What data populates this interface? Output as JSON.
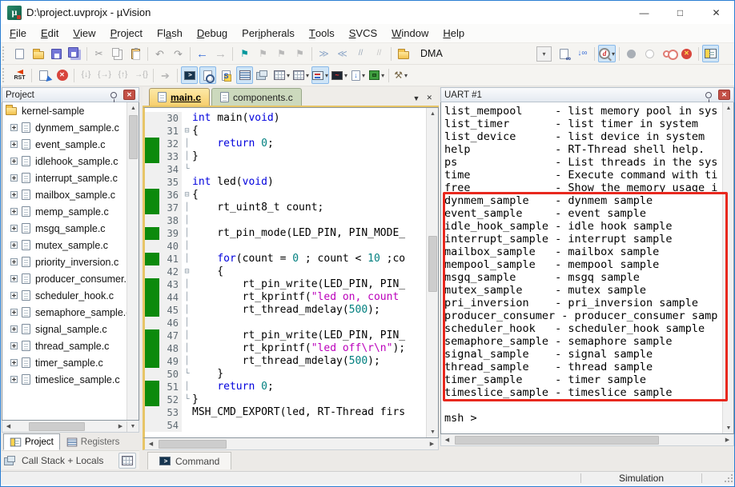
{
  "window": {
    "title": "D:\\project.uvprojx - µVision",
    "controls": {
      "minimize": "—",
      "maximize": "□",
      "close": "✕"
    }
  },
  "menu": {
    "items": [
      {
        "t": "File",
        "u": 0
      },
      {
        "t": "Edit",
        "u": 0
      },
      {
        "t": "View",
        "u": 0
      },
      {
        "t": "Project",
        "u": 0
      },
      {
        "t": "Flash",
        "u": 2
      },
      {
        "t": "Debug",
        "u": 0
      },
      {
        "t": "Peripherals",
        "u": 3
      },
      {
        "t": "Tools",
        "u": 0
      },
      {
        "t": "SVCS",
        "u": 0
      },
      {
        "t": "Window",
        "u": 0
      },
      {
        "t": "Help",
        "u": 0
      }
    ]
  },
  "toolbars": {
    "row1": [
      {
        "n": "new-file-button",
        "cls": "i-doc"
      },
      {
        "n": "open-file-button",
        "cls": "i-folder"
      },
      {
        "n": "save-button",
        "cls": "i-floppy"
      },
      {
        "n": "save-all-button",
        "cls": "i-floppy2"
      },
      {
        "sep": true
      },
      {
        "n": "cut-button",
        "g": "✂",
        "c": "#9a9a9a",
        "fs": 12
      },
      {
        "n": "copy-button",
        "cls": "i-copy"
      },
      {
        "n": "paste-button",
        "cls": "i-clip"
      },
      {
        "sep": true
      },
      {
        "n": "undo-button",
        "g": "↶",
        "c": "#9a9a9a",
        "fs": 13
      },
      {
        "n": "redo-button",
        "g": "↷",
        "c": "#9a9a9a",
        "fs": 13
      },
      {
        "sep": true
      },
      {
        "n": "navigate-back-button",
        "g": "←",
        "c": "#3a6fd8",
        "fs": 15
      },
      {
        "n": "navigate-forward-button",
        "g": "→",
        "c": "#b9b9b9",
        "fs": 15
      },
      {
        "sep": true
      },
      {
        "n": "insert-bookmark-button",
        "g": "⚑",
        "c": "#00979c",
        "fs": 12
      },
      {
        "n": "previous-bookmark-button",
        "g": "⚑",
        "c": "#b9b9b9",
        "fs": 12
      },
      {
        "n": "next-bookmark-button",
        "g": "⚑",
        "c": "#b9b9b9",
        "fs": 12
      },
      {
        "n": "clear-bookmarks-button",
        "g": "⚑",
        "c": "#b9b9b9",
        "fs": 12
      },
      {
        "sep": true
      },
      {
        "n": "indent-button",
        "g": "≫",
        "c": "#8fa8c8",
        "fs": 12
      },
      {
        "n": "outdent-button",
        "g": "≪",
        "c": "#8fa8c8",
        "fs": 12
      },
      {
        "n": "comment-button",
        "g": "//",
        "c": "#9aa8b8",
        "fs": 10
      },
      {
        "n": "uncomment-button",
        "g": "//",
        "c": "#c3c3c3",
        "fs": 10
      },
      {
        "sep": true
      },
      {
        "n": "configure-target-button",
        "cls": "i-folder"
      },
      {
        "n": "target-select",
        "combo": true,
        "v": "DMA"
      },
      {
        "n": "find-in-files-button",
        "cls": "i-docfind"
      },
      {
        "n": "incremental-find-button",
        "g": "↓∞",
        "c": "#3a6fd8",
        "fs": 10
      },
      {
        "sep": true
      },
      {
        "n": "find-button",
        "cls": "i-qfind",
        "hl": true,
        "dd": true
      },
      {
        "sep": true
      },
      {
        "n": "insert-breakpoint-button",
        "cls": "i-bp-gray"
      },
      {
        "n": "enable-disable-breakpoint-button",
        "cls": "i-bp-hollow"
      },
      {
        "n": "disable-all-breakpoints-button",
        "cls": "i-bp-red2"
      },
      {
        "n": "kill-all-breakpoints-button",
        "cls": "i-bp-redx"
      },
      {
        "sep": true
      },
      {
        "n": "project-window-toggle-button",
        "cls": "i-projwin",
        "hl": true
      }
    ],
    "row2": [
      {
        "n": "reset-button",
        "cls": "i-rst",
        "g": "RST"
      },
      {
        "sep": true
      },
      {
        "n": "run-button",
        "cls": "i-run"
      },
      {
        "n": "stop-button",
        "cls": "i-stopx"
      },
      {
        "sep": true
      },
      {
        "n": "step-button",
        "g": "{↓}",
        "c": "#b5b5b5",
        "fs": 10
      },
      {
        "n": "step-over-button",
        "g": "{→}",
        "c": "#b5b5b5",
        "fs": 10
      },
      {
        "n": "step-out-button",
        "g": "{↑}",
        "c": "#b5b5b5",
        "fs": 10
      },
      {
        "n": "run-to-cursor-button",
        "g": "→{}",
        "c": "#b5b5b5",
        "fs": 10
      },
      {
        "sep": true
      },
      {
        "n": "show-next-statement-button",
        "g": "➔",
        "c": "#b5b5b5",
        "fs": 13
      },
      {
        "sep": true
      },
      {
        "n": "command-window-button",
        "cls": "i-console",
        "hl": true
      },
      {
        "n": "disassembly-window-button",
        "cls": "i-disasm",
        "hl": true
      },
      {
        "n": "symbols-window-button",
        "cls": "i-symbols"
      },
      {
        "n": "registers-window-button",
        "cls": "i-reglines",
        "hl": true
      },
      {
        "n": "call-stack-window-button",
        "cls": "i-stack"
      },
      {
        "n": "watch-window-button",
        "cls": "i-grid",
        "dd": true
      },
      {
        "n": "memory-window-button",
        "cls": "i-grid",
        "dd": true
      },
      {
        "n": "serial-window-button",
        "cls": "i-serial",
        "hl": true,
        "dd": true
      },
      {
        "n": "analysis-window-button",
        "cls": "i-analysis",
        "dd": true
      },
      {
        "n": "trace-window-button",
        "cls": "i-trace",
        "dd": true
      },
      {
        "n": "system-viewer-button",
        "cls": "i-chip",
        "dd": true
      },
      {
        "sep": true
      },
      {
        "n": "toolbox-button",
        "g": "⚒",
        "c": "#7a6a4a",
        "fs": 12,
        "dd": true
      }
    ]
  },
  "project": {
    "title": "Project",
    "root": "kernel-sample",
    "files": [
      "dynmem_sample.c",
      "event_sample.c",
      "idlehook_sample.c",
      "interrupt_sample.c",
      "mailbox_sample.c",
      "memp_sample.c",
      "msgq_sample.c",
      "mutex_sample.c",
      "priority_inversion.c",
      "producer_consumer.c",
      "scheduler_hook.c",
      "semaphore_sample.c",
      "signal_sample.c",
      "thread_sample.c",
      "timer_sample.c",
      "timeslice_sample.c"
    ],
    "tabs": [
      {
        "label": "Project",
        "icon": "i-projwin",
        "active": true
      },
      {
        "label": "Registers",
        "icon": "i-reglines",
        "active": false
      }
    ],
    "callstack_label": "Call Stack + Locals"
  },
  "editor": {
    "tabs": [
      {
        "label": "main.c",
        "active": true
      },
      {
        "label": "components.c",
        "active": false
      }
    ],
    "lines": [
      {
        "n": 30,
        "f": "",
        "b": 0,
        "t": [
          [
            "k",
            "int"
          ],
          [
            "p",
            " main("
          ],
          [
            "k",
            "void"
          ],
          [
            "p",
            ")"
          ]
        ]
      },
      {
        "n": 31,
        "f": "⊟",
        "b": 0,
        "t": [
          [
            "p",
            "{"
          ]
        ]
      },
      {
        "n": 32,
        "f": "│",
        "b": 1,
        "t": [
          [
            "p",
            "    "
          ],
          [
            "k",
            "return"
          ],
          [
            "p",
            " "
          ],
          [
            "nu",
            "0"
          ],
          [
            "p",
            ";"
          ]
        ]
      },
      {
        "n": 33,
        "f": "│",
        "b": 1,
        "t": [
          [
            "p",
            "}"
          ]
        ]
      },
      {
        "n": 34,
        "f": "└",
        "b": 0,
        "t": []
      },
      {
        "n": 35,
        "f": "",
        "b": 0,
        "t": [
          [
            "k",
            "int"
          ],
          [
            "p",
            " led("
          ],
          [
            "k",
            "void"
          ],
          [
            "p",
            ")"
          ]
        ]
      },
      {
        "n": 36,
        "f": "⊟",
        "b": 1,
        "t": [
          [
            "p",
            "{"
          ]
        ]
      },
      {
        "n": 37,
        "f": "│",
        "b": 1,
        "t": [
          [
            "p",
            "    rt_uint8_t count;"
          ]
        ]
      },
      {
        "n": 38,
        "f": "│",
        "b": 0,
        "t": []
      },
      {
        "n": 39,
        "f": "│",
        "b": 1,
        "t": [
          [
            "p",
            "    rt_pin_mode(LED_PIN, PIN_MODE_"
          ]
        ]
      },
      {
        "n": 40,
        "f": "│",
        "b": 0,
        "t": []
      },
      {
        "n": 41,
        "f": "│",
        "b": 1,
        "t": [
          [
            "p",
            "    "
          ],
          [
            "k",
            "for"
          ],
          [
            "p",
            "(count = "
          ],
          [
            "nu",
            "0"
          ],
          [
            "p",
            " ; count < "
          ],
          [
            "nu",
            "10"
          ],
          [
            "p",
            " ;co"
          ]
        ]
      },
      {
        "n": 42,
        "f": "⊟",
        "b": 0,
        "t": [
          [
            "p",
            "    {"
          ]
        ]
      },
      {
        "n": 43,
        "f": "│",
        "b": 1,
        "t": [
          [
            "p",
            "        rt_pin_write(LED_PIN, PIN_"
          ]
        ]
      },
      {
        "n": 44,
        "f": "│",
        "b": 1,
        "t": [
          [
            "p",
            "        rt_kprintf("
          ],
          [
            "s",
            "\"led on, count"
          ]
        ]
      },
      {
        "n": 45,
        "f": "│",
        "b": 1,
        "t": [
          [
            "p",
            "        rt_thread_mdelay("
          ],
          [
            "nu",
            "500"
          ],
          [
            "p",
            ");"
          ]
        ]
      },
      {
        "n": 46,
        "f": "│",
        "b": 0,
        "t": []
      },
      {
        "n": 47,
        "f": "│",
        "b": 1,
        "t": [
          [
            "p",
            "        rt_pin_write(LED_PIN, PIN_"
          ]
        ]
      },
      {
        "n": 48,
        "f": "│",
        "b": 1,
        "t": [
          [
            "p",
            "        rt_kprintf("
          ],
          [
            "s",
            "\"led off\\r\\n\""
          ],
          [
            "p",
            ");"
          ]
        ]
      },
      {
        "n": 49,
        "f": "│",
        "b": 1,
        "t": [
          [
            "p",
            "        rt_thread_mdelay("
          ],
          [
            "nu",
            "500"
          ],
          [
            "p",
            ");"
          ]
        ]
      },
      {
        "n": 50,
        "f": "└",
        "b": 0,
        "t": [
          [
            "p",
            "    }"
          ]
        ]
      },
      {
        "n": 51,
        "f": "│",
        "b": 1,
        "t": [
          [
            "p",
            "    "
          ],
          [
            "k",
            "return"
          ],
          [
            "p",
            " "
          ],
          [
            "nu",
            "0"
          ],
          [
            "p",
            ";"
          ]
        ]
      },
      {
        "n": 52,
        "f": "└",
        "b": 1,
        "t": [
          [
            "p",
            "}"
          ]
        ]
      },
      {
        "n": 53,
        "f": "",
        "b": 0,
        "t": [
          [
            "p",
            "MSH_CMD_EXPORT(led, RT-Thread firs"
          ]
        ]
      },
      {
        "n": 54,
        "f": "",
        "b": 0,
        "t": []
      }
    ],
    "command_label": "Command"
  },
  "uart": {
    "title": "UART #1",
    "lines": [
      "list_mempool     - list memory pool in sys",
      "list_timer       - list timer in system",
      "list_device      - list device in system",
      "help             - RT-Thread shell help.",
      "ps               - List threads in the sys",
      "time             - Execute command with ti",
      "free             - Show the memory usage i",
      "dynmem_sample    - dynmem sample",
      "event_sample     - event sample",
      "idle_hook_sample - idle hook sample",
      "interrupt_sample - interrupt sample",
      "mailbox_sample   - mailbox sample",
      "mempool_sample   - mempool sample",
      "msgq_sample      - msgq sample",
      "mutex_sample     - mutex sample",
      "pri_inversion    - pri_inversion sample",
      "producer_consumer - producer_consumer samp",
      "scheduler_hook   - scheduler_hook sample",
      "semaphore_sample - semaphore sample",
      "signal_sample    - signal sample",
      "thread_sample    - thread sample",
      "timer_sample     - timer sample",
      "timeslice_sample - timeslice sample",
      "",
      "msh >"
    ],
    "highlight": {
      "from": 7,
      "to": 22
    }
  },
  "status": {
    "simulation": "Simulation"
  },
  "colors": {
    "annotation": "#e8281e",
    "toolbar_highlight": "#cfe5f7",
    "change_bar": "#0c8a0c",
    "keyword": "#0000dd",
    "number": "#007f7f",
    "string": "#bb00bb",
    "active_tab": "#f7cf6e"
  }
}
